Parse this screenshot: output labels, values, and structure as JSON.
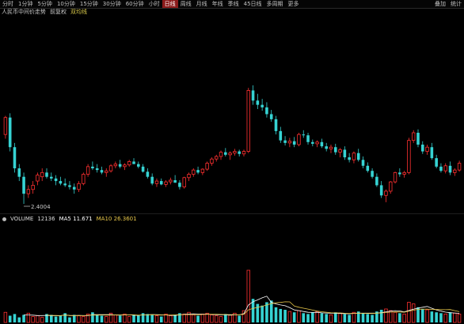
{
  "toolbar": {
    "items": [
      {
        "label": "分时"
      },
      {
        "label": "1分钟"
      },
      {
        "label": "5分钟"
      },
      {
        "label": "10分钟"
      },
      {
        "label": "15分钟"
      },
      {
        "label": "30分钟"
      },
      {
        "label": "60分钟"
      },
      {
        "label": "小时"
      },
      {
        "label": "日线",
        "active": true
      },
      {
        "label": "周线"
      },
      {
        "label": "月线"
      },
      {
        "label": "年线"
      },
      {
        "label": "季线"
      },
      {
        "label": "45日线"
      },
      {
        "label": "多周期"
      },
      {
        "label": "更多"
      }
    ],
    "right_items": [
      {
        "label": "叠加"
      },
      {
        "label": "统计"
      }
    ]
  },
  "info": {
    "title": "人民币中间价走势",
    "mode": "前复权",
    "indicator": "双均线"
  },
  "chart_data": {
    "type": "candlestick",
    "annotations": [
      {
        "text": "2.4004"
      }
    ],
    "candles": [
      [
        68.0,
        70.2,
        67.5,
        70.0
      ],
      [
        70.0,
        70.5,
        66.0,
        66.5
      ],
      [
        66.5,
        67.0,
        63.5,
        64.0
      ],
      [
        64.0,
        64.5,
        62.5,
        63.0
      ],
      [
        63.0,
        63.5,
        59.8,
        61.0
      ],
      [
        61.0,
        62.0,
        60.5,
        61.5
      ],
      [
        61.5,
        62.5,
        61.0,
        62.0
      ],
      [
        62.5,
        63.5,
        62.0,
        63.2
      ],
      [
        63.0,
        64.0,
        62.5,
        63.5
      ],
      [
        63.5,
        64.0,
        62.8,
        63.0
      ],
      [
        63.0,
        63.5,
        62.5,
        62.8
      ],
      [
        62.8,
        63.2,
        62.0,
        62.5
      ],
      [
        62.5,
        63.0,
        62.0,
        62.2
      ],
      [
        62.2,
        62.8,
        61.8,
        62.0
      ],
      [
        62.0,
        62.5,
        61.5,
        61.8
      ],
      [
        61.8,
        62.2,
        61.0,
        61.5
      ],
      [
        61.5,
        62.5,
        61.2,
        62.2
      ],
      [
        62.2,
        63.5,
        62.0,
        63.3
      ],
      [
        63.3,
        64.5,
        63.0,
        64.2
      ],
      [
        64.2,
        64.8,
        63.8,
        64.0
      ],
      [
        64.0,
        64.5,
        63.5,
        63.8
      ],
      [
        63.8,
        64.2,
        63.3,
        63.5
      ],
      [
        63.5,
        64.0,
        63.0,
        63.7
      ],
      [
        63.7,
        64.5,
        63.5,
        64.3
      ],
      [
        64.3,
        64.8,
        64.0,
        64.5
      ],
      [
        64.5,
        65.0,
        64.0,
        64.2
      ],
      [
        64.2,
        64.6,
        63.8,
        64.4
      ],
      [
        64.4,
        65.0,
        64.2,
        64.8
      ],
      [
        64.8,
        65.2,
        64.5,
        64.5
      ],
      [
        64.5,
        64.8,
        64.0,
        64.2
      ],
      [
        64.2,
        64.5,
        63.5,
        63.6
      ],
      [
        63.6,
        64.0,
        62.8,
        63.0
      ],
      [
        63.0,
        63.4,
        62.0,
        62.2
      ],
      [
        62.2,
        62.8,
        61.8,
        62.5
      ],
      [
        62.5,
        62.8,
        62.0,
        62.1
      ],
      [
        62.1,
        62.6,
        61.8,
        62.4
      ],
      [
        62.4,
        62.9,
        62.1,
        62.6
      ],
      [
        62.6,
        63.2,
        62.3,
        62.3
      ],
      [
        62.3,
        62.6,
        61.5,
        61.8
      ],
      [
        61.8,
        63.0,
        61.6,
        62.9
      ],
      [
        62.9,
        63.5,
        62.5,
        63.3
      ],
      [
        63.3,
        64.0,
        63.0,
        63.8
      ],
      [
        63.8,
        64.2,
        63.3,
        63.5
      ],
      [
        63.5,
        64.0,
        63.2,
        63.9
      ],
      [
        63.9,
        64.8,
        63.7,
        64.6
      ],
      [
        64.6,
        65.3,
        64.3,
        65.1
      ],
      [
        65.1,
        65.6,
        64.8,
        65.4
      ],
      [
        65.4,
        66.1,
        65.0,
        65.9
      ],
      [
        65.9,
        66.4,
        65.4,
        65.6
      ],
      [
        65.6,
        66.0,
        65.0,
        65.8
      ],
      [
        65.8,
        66.3,
        65.5,
        66.0
      ],
      [
        66.0,
        66.2,
        65.4,
        65.7
      ],
      [
        65.7,
        66.2,
        65.4,
        66.0
      ],
      [
        66.0,
        73.5,
        65.8,
        73.2
      ],
      [
        73.2,
        73.8,
        71.5,
        72.0
      ],
      [
        72.0,
        72.8,
        71.0,
        71.5
      ],
      [
        71.5,
        72.2,
        70.8,
        71.2
      ],
      [
        71.2,
        71.8,
        70.0,
        70.4
      ],
      [
        70.4,
        70.9,
        69.5,
        69.8
      ],
      [
        69.8,
        70.2,
        68.0,
        68.4
      ],
      [
        68.4,
        68.9,
        67.0,
        67.3
      ],
      [
        67.3,
        67.8,
        66.7,
        67.0
      ],
      [
        67.0,
        67.6,
        66.5,
        67.2
      ],
      [
        67.2,
        67.7,
        66.5,
        66.8
      ],
      [
        66.8,
        68.2,
        66.6,
        68.0
      ],
      [
        68.0,
        68.5,
        67.6,
        67.9
      ],
      [
        67.9,
        68.2,
        66.8,
        67.1
      ],
      [
        67.1,
        67.4,
        66.6,
        66.9
      ],
      [
        66.9,
        67.3,
        66.5,
        67.1
      ],
      [
        67.1,
        67.5,
        66.4,
        66.6
      ],
      [
        66.6,
        67.0,
        66.0,
        66.3
      ],
      [
        66.3,
        66.8,
        65.8,
        66.5
      ],
      [
        66.5,
        66.9,
        65.6,
        65.9
      ],
      [
        65.9,
        66.4,
        65.3,
        66.2
      ],
      [
        66.2,
        66.6,
        65.0,
        65.3
      ],
      [
        65.3,
        65.8,
        64.7,
        65.0
      ],
      [
        65.0,
        66.0,
        64.6,
        65.8
      ],
      [
        65.8,
        66.3,
        64.8,
        65.0
      ],
      [
        65.0,
        65.4,
        64.0,
        64.3
      ],
      [
        64.3,
        64.7,
        63.5,
        63.7
      ],
      [
        63.7,
        64.0,
        62.8,
        63.0
      ],
      [
        63.0,
        63.4,
        61.8,
        62.0
      ],
      [
        62.0,
        62.5,
        60.5,
        60.8
      ],
      [
        60.8,
        61.5,
        60.0,
        61.3
      ],
      [
        61.3,
        62.5,
        61.0,
        62.4
      ],
      [
        62.4,
        63.6,
        62.2,
        63.5
      ],
      [
        63.5,
        64.0,
        63.0,
        63.3
      ],
      [
        63.3,
        63.7,
        62.9,
        63.5
      ],
      [
        63.5,
        67.6,
        63.3,
        67.3
      ],
      [
        67.3,
        68.5,
        67.0,
        68.2
      ],
      [
        68.2,
        68.6,
        66.5,
        66.8
      ],
      [
        66.8,
        67.2,
        65.7,
        66.0
      ],
      [
        66.0,
        66.8,
        65.6,
        66.5
      ],
      [
        66.5,
        67.0,
        65.0,
        65.2
      ],
      [
        65.2,
        65.6,
        64.0,
        64.2
      ],
      [
        64.2,
        64.6,
        63.5,
        63.7
      ],
      [
        63.7,
        64.6,
        63.4,
        64.3
      ],
      [
        64.3,
        64.8,
        63.2,
        63.5
      ],
      [
        63.5,
        64.0,
        63.1,
        63.8
      ],
      [
        63.8,
        64.9,
        63.6,
        64.6
      ]
    ],
    "volume": [
      12,
      8,
      10,
      6,
      9,
      11,
      7,
      8,
      6,
      10,
      9,
      7,
      8,
      11,
      6,
      9,
      8,
      7,
      10,
      12,
      9,
      8,
      7,
      11,
      9,
      8,
      10,
      7,
      9,
      8,
      11,
      10,
      9,
      8,
      7,
      10,
      8,
      9,
      11,
      10,
      12,
      9,
      8,
      10,
      11,
      9,
      8,
      7,
      10,
      9,
      11,
      8,
      14,
      62,
      28,
      22,
      20,
      24,
      26,
      18,
      16,
      15,
      13,
      12,
      14,
      11,
      10,
      12,
      13,
      11,
      10,
      9,
      12,
      11,
      10,
      9,
      12,
      13,
      11,
      10,
      9,
      13,
      15,
      16,
      14,
      12,
      11,
      10,
      24,
      22,
      18,
      16,
      15,
      13,
      12,
      11,
      10,
      12,
      11,
      10
    ],
    "ma5_vol": 11.671,
    "ma10_vol": 26.3601
  },
  "volume": {
    "title": "VOLUME",
    "value": "12136",
    "ma5_label": "MA5",
    "ma5_value": "11.671",
    "ma10_label": "MA10",
    "ma10_value": "26.3601"
  },
  "colors": {
    "up": "#ff3030",
    "down": "#36d3d3",
    "ma5": "#ffffff",
    "ma10": "#e8c84a",
    "background": "#000000"
  }
}
